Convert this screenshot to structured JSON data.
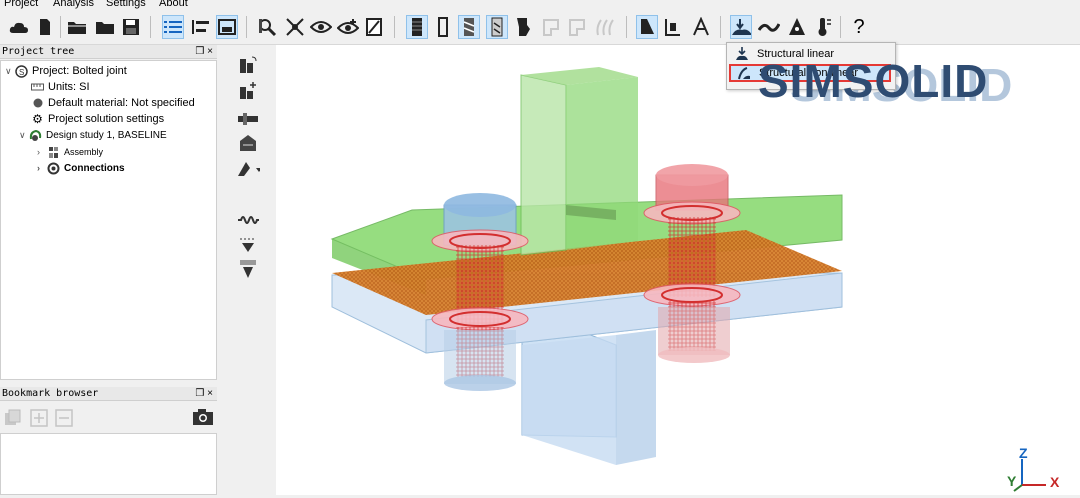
{
  "menu": {
    "items": [
      "Project",
      "Analysis",
      "Settings",
      "About"
    ]
  },
  "toolbar": {
    "icons": [
      "cloud-icon",
      "new-file-icon",
      "open-folder-icon",
      "folder-icon",
      "save-icon",
      "list-view-icon",
      "parts-view-icon",
      "tray-icon",
      "search-part-icon",
      "hide-icon",
      "eye-icon",
      "show-icon",
      "snapshot-icon",
      "solid-icon",
      "outline-icon",
      "edges-icon",
      "hidden-edges-icon",
      "surface-icon",
      "mesh-icon",
      "wire-icon",
      "wavy-icon",
      "section-icon",
      "measure-icon",
      "text-icon",
      "analysis-icon",
      "thermal-icon",
      "stress-icon",
      "temperature-icon",
      "help-icon"
    ],
    "help_label": "?"
  },
  "project_tree": {
    "title": "Project tree",
    "controls": "❒ ×",
    "items": [
      {
        "label": "Project: Bolted joint",
        "icon": "project-icon",
        "expand": "∨"
      },
      {
        "label": "Units: SI",
        "icon": "ruler-icon",
        "expand": ""
      },
      {
        "label": "Default material: Not specified",
        "icon": "material-icon",
        "expand": ""
      },
      {
        "label": "Project solution settings",
        "icon": "settings-icon",
        "expand": ""
      },
      {
        "label": "Design study 1, BASELINE",
        "icon": "study-icon",
        "expand": "∨"
      },
      {
        "label": "Assembly",
        "icon": "assembly-icon",
        "expand": "›"
      },
      {
        "label": "Connections",
        "icon": "connections-icon",
        "expand": "›"
      }
    ]
  },
  "bookmark_browser": {
    "title": "Bookmark browser",
    "controls": "❒ ×"
  },
  "analysis_menu": {
    "items": [
      {
        "label": "Structural linear",
        "icon": "structural-linear-icon",
        "highlighted": false
      },
      {
        "label": "Structural non-linear",
        "icon": "structural-nonlinear-icon",
        "highlighted": true
      }
    ]
  },
  "brand": {
    "logo_text": "SIMSOLID",
    "colors": {
      "plate": "#84d86a",
      "bolt_blue": "#9cc3e6",
      "bolt_red": "#e8737a",
      "mesh": "#d32f2f",
      "contact": "#e07b22",
      "accent": "#e53935"
    }
  },
  "triad": {
    "z": "Z",
    "y": "Y",
    "x": "X"
  }
}
